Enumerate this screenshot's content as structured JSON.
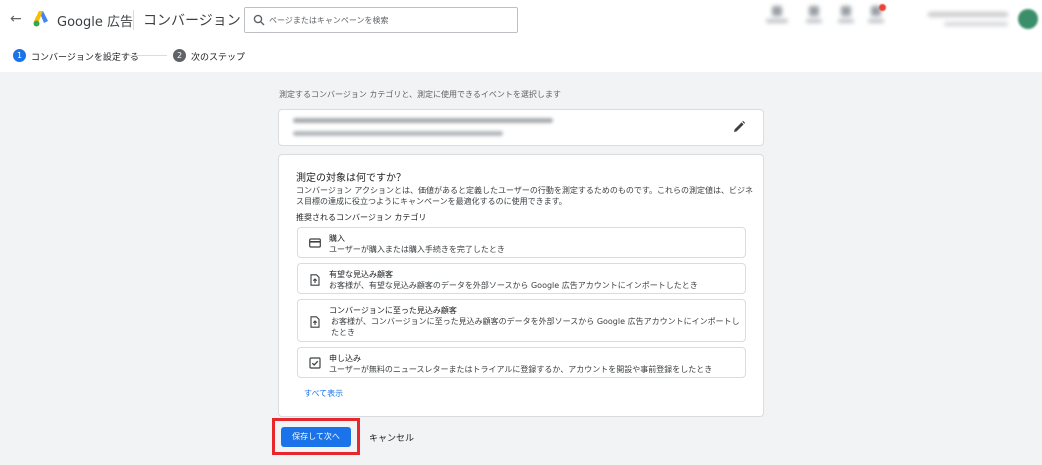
{
  "header": {
    "brand": "Google 広告",
    "page_title": "コンバージョン",
    "search_placeholder": "ページまたはキャンペーンを検索",
    "colors": {
      "logo_blue": "#4285f4",
      "logo_yellow": "#fbbc04",
      "logo_green": "#34a853"
    }
  },
  "stepper": {
    "steps": [
      {
        "number": "1",
        "label": "コンバージョンを設定する",
        "active": true
      },
      {
        "number": "2",
        "label": "次のステップ",
        "active": false
      }
    ]
  },
  "main": {
    "instruction": "測定するコンバージョン カテゴリと、測定に使用できるイベントを選択します",
    "question": "測定の対象は何ですか？",
    "description": "コンバージョン アクションとは、価値があると定義したユーザーの行動を測定するためのものです。これらの測定値は、ビジネス目標の達成に役立つようにキャンペーンを最適化するのに使用できます。",
    "recommended_label": "推奨されるコンバージョン カテゴリ",
    "options": [
      {
        "title": "購入",
        "desc": "ユーザーが購入または購入手続きを完了したとき",
        "icon": "credit-card-icon"
      },
      {
        "title": "有望な見込み顧客",
        "desc": "お客様が、有望な見込み顧客のデータを外部ソースから Google 広告アカウントにインポートしたとき",
        "icon": "file-upload-icon"
      },
      {
        "title": "コンバージョンに至った見込み顧客",
        "desc": "お客様が、コンバージョンに至った見込み顧客のデータを外部ソースから Google 広告アカウントにインポートしたとき",
        "icon": "file-upload-icon"
      },
      {
        "title": "申し込み",
        "desc": "ユーザーが無料のニュースレターまたはトライアルに登録するか、アカウントを開設や事前登録をしたとき",
        "icon": "check-box-icon"
      }
    ],
    "show_all": "すべて表示"
  },
  "footer": {
    "save_label": "保存して次へ",
    "cancel_label": "キャンセル",
    "highlight_color": "#e8272d"
  }
}
